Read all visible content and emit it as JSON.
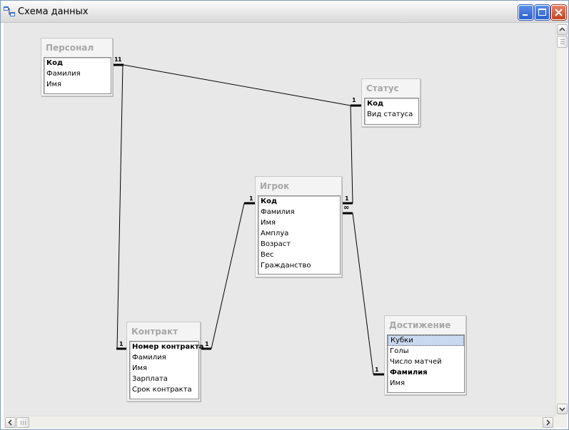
{
  "window": {
    "title": "Схема данных",
    "minimize_icon": "minimize-icon",
    "maximize_icon": "maximize-icon",
    "close_icon": "close-icon"
  },
  "tables": {
    "personal": {
      "title": "Персонал",
      "fields": [
        "Код",
        "Фамилия",
        "Имя"
      ]
    },
    "status": {
      "title": "Статус",
      "fields": [
        "Код",
        "Вид статуса"
      ]
    },
    "igrok": {
      "title": "Игрок",
      "fields": [
        "Код",
        "Фамилия",
        "Имя",
        "Амплуа",
        "Возраст",
        "Вес",
        "Гражданство"
      ]
    },
    "kontrakt": {
      "title": "Контракт",
      "fields": [
        "Номер контракта",
        "Фамилия",
        "Имя",
        "Зарплата",
        "Срок контракта"
      ]
    },
    "dostizhenie": {
      "title": "Достижение",
      "fields": [
        "Кубки",
        "Голы",
        "Число матчей",
        "Фамилия",
        "Имя"
      ]
    }
  },
  "relationships": {
    "personal_status": {
      "from": "1",
      "to": "1"
    },
    "personal_kontrakt": {
      "from": "1",
      "to": "1"
    },
    "kontrakt_igrok": {
      "from": "1",
      "to": "1"
    },
    "status_igrok": {
      "from": "1",
      "to": "1"
    },
    "igrok_dostizhenie": {
      "from": "∞",
      "to": "1"
    }
  }
}
